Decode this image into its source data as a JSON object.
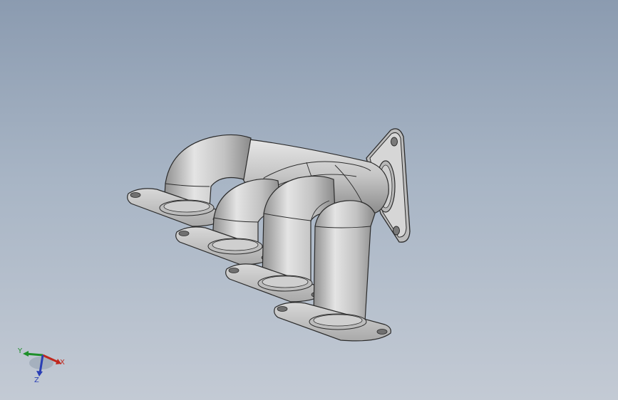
{
  "viewport": {
    "background_top": "#8b9bb0",
    "background_bottom": "#c3cad4",
    "model_color": "#c9c9c9",
    "edge_color": "#2b2b2b"
  },
  "triad": {
    "x_label": "X",
    "y_label": "Y",
    "z_label": "Z",
    "x_color": "#c0281e",
    "y_color": "#1e8f2a",
    "z_color": "#2a3fb5"
  }
}
